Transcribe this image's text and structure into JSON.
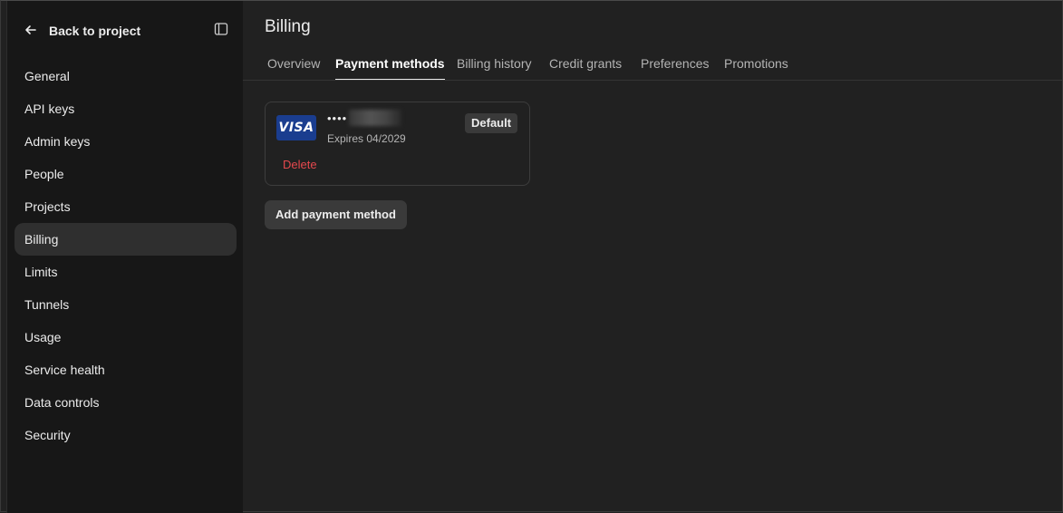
{
  "sidebar": {
    "back_label": "Back to project",
    "items": [
      {
        "label": "General"
      },
      {
        "label": "API keys"
      },
      {
        "label": "Admin keys"
      },
      {
        "label": "People"
      },
      {
        "label": "Projects"
      },
      {
        "label": "Billing",
        "active": true
      },
      {
        "label": "Limits"
      },
      {
        "label": "Tunnels"
      },
      {
        "label": "Usage"
      },
      {
        "label": "Service health"
      },
      {
        "label": "Data controls"
      },
      {
        "label": "Security"
      }
    ]
  },
  "page": {
    "title": "Billing"
  },
  "tabs": [
    {
      "label": "Overview"
    },
    {
      "label": "Payment methods",
      "active": true
    },
    {
      "label": "Billing history"
    },
    {
      "label": "Credit grants"
    },
    {
      "label": "Preferences"
    },
    {
      "label": "Promotions"
    }
  ],
  "payment_card": {
    "brand": "VISA",
    "masked_number": "••••",
    "expires": "Expires 04/2029",
    "badge": "Default",
    "delete_label": "Delete"
  },
  "add_button_label": "Add payment method",
  "colors": {
    "background": "#212121",
    "sidebar": "#171717",
    "active_item": "#2f2f2f",
    "danger": "#e5484d",
    "visa_blue": "#1a3d8f"
  }
}
